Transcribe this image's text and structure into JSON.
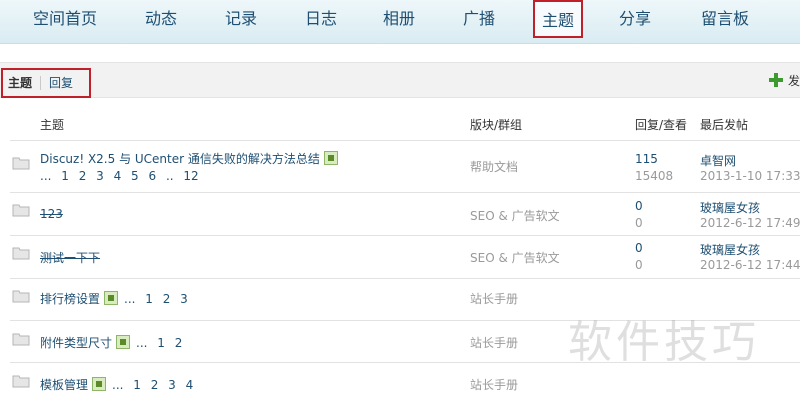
{
  "nav": {
    "items": [
      {
        "label": "空间首页",
        "active": false
      },
      {
        "label": "动态",
        "active": false
      },
      {
        "label": "记录",
        "active": false
      },
      {
        "label": "日志",
        "active": false
      },
      {
        "label": "相册",
        "active": false
      },
      {
        "label": "广播",
        "active": false
      },
      {
        "label": "主题",
        "active": true
      },
      {
        "label": "分享",
        "active": false
      },
      {
        "label": "留言板",
        "active": false
      }
    ]
  },
  "subtabs": {
    "topic": "主题",
    "reply": "回复",
    "post": "发"
  },
  "table": {
    "headers": {
      "subject": "主题",
      "forum": "版块/群组",
      "stats": "回复/查看",
      "last_post": "最后发帖"
    },
    "rows": [
      {
        "title": "Discuz! X2.5 与 UCenter 通信失败的解决方法总结",
        "strike": false,
        "attach": true,
        "pages": "... 1 2 3 4 5 6 .. 12",
        "forum": "帮助文档",
        "replies": "115",
        "views": "15408",
        "author": "卓智网",
        "time": "2013-1-10 17:33"
      },
      {
        "title": "123",
        "strike": true,
        "attach": false,
        "pages": "",
        "forum": "SEO & 广告软文",
        "replies": "0",
        "views": "0",
        "author": "玻璃屋女孩",
        "time": "2012-6-12 17:49"
      },
      {
        "title": "测试一下下",
        "strike": true,
        "attach": false,
        "pages": "",
        "forum": "SEO & 广告软文",
        "replies": "0",
        "views": "0",
        "author": "玻璃屋女孩",
        "time": "2012-6-12 17:44"
      },
      {
        "title": "排行榜设置",
        "strike": false,
        "attach": true,
        "pages": "... 1 2 3",
        "forum": "站长手册",
        "replies": "",
        "views": "",
        "author": "",
        "time": ""
      },
      {
        "title": "附件类型尺寸",
        "strike": false,
        "attach": true,
        "pages": "... 1 2",
        "forum": "站长手册",
        "replies": "",
        "views": "",
        "author": "",
        "time": ""
      },
      {
        "title": "模板管理",
        "strike": false,
        "attach": true,
        "pages": "... 1 2 3 4",
        "forum": "站长手册",
        "replies": "",
        "views": "",
        "author": "",
        "time": ""
      }
    ]
  },
  "watermark": "软件技巧",
  "colors": {
    "accent_red": "#c0202a",
    "link_blue": "#1e4f72",
    "nav_bg": "#d9ecf2"
  }
}
